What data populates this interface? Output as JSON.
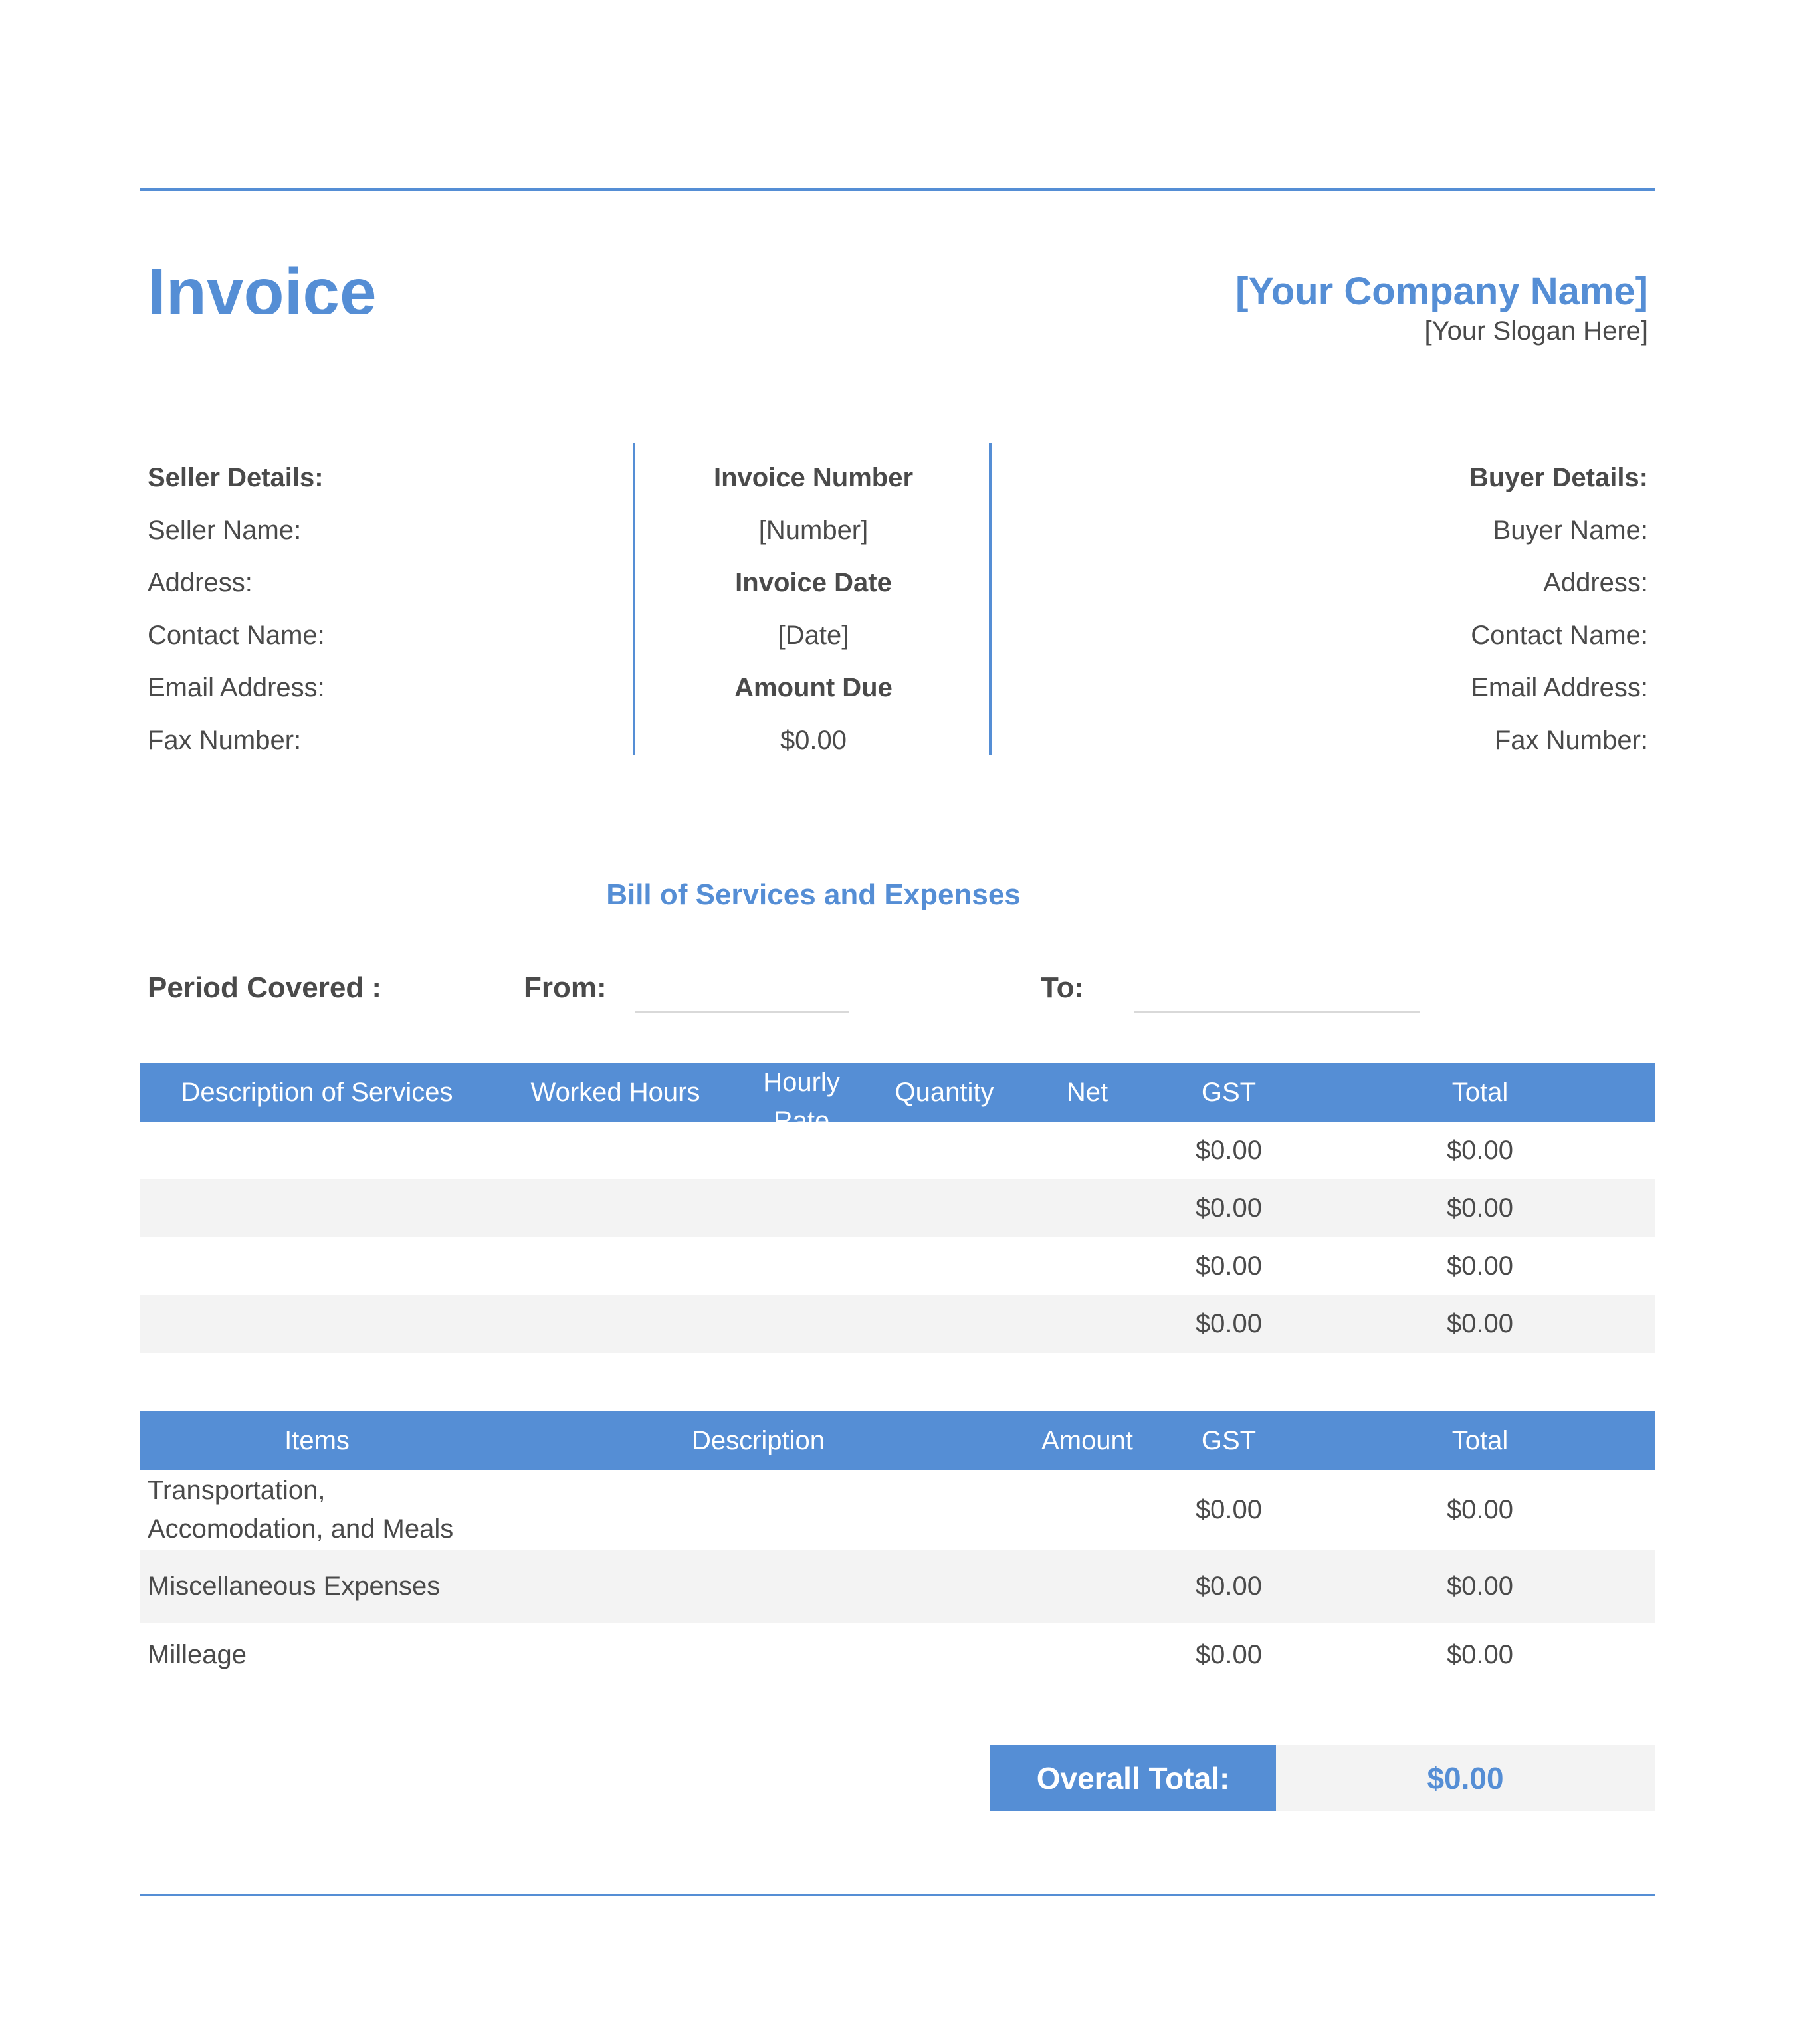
{
  "header": {
    "title": "Invoice",
    "company_name": "[Your Company Name]",
    "slogan": "[Your Slogan Here]"
  },
  "seller": {
    "heading": "Seller Details:",
    "fields": [
      "Seller Name:",
      "Address:",
      "Contact Name:",
      "Email Address:",
      "Fax Number:"
    ]
  },
  "invoice_info": {
    "number_label": "Invoice Number",
    "number_value": "[Number]",
    "date_label": "Invoice Date",
    "date_value": "[Date]",
    "amount_label": "Amount Due",
    "amount_value": "$0.00"
  },
  "buyer": {
    "heading": "Buyer Details:",
    "fields": [
      "Buyer Name:",
      "Address:",
      "Contact Name:",
      "Email Address:",
      "Fax Number:"
    ]
  },
  "bill_title": "Bill of Services and Expenses",
  "period": {
    "label": "Period Covered :",
    "from_label": "From:",
    "from_value": "",
    "to_label": "To:",
    "to_value": ""
  },
  "services_table": {
    "headers": [
      "Description of Services",
      "Worked Hours",
      "Hourly Rate",
      "Quantity",
      "Net",
      "GST",
      "Total"
    ],
    "rows": [
      [
        "",
        "",
        "",
        "",
        "",
        "$0.00",
        "$0.00"
      ],
      [
        "",
        "",
        "",
        "",
        "",
        "$0.00",
        "$0.00"
      ],
      [
        "",
        "",
        "",
        "",
        "",
        "$0.00",
        "$0.00"
      ],
      [
        "",
        "",
        "",
        "",
        "",
        "$0.00",
        "$0.00"
      ]
    ]
  },
  "expenses_table": {
    "headers": [
      "Items",
      "Description",
      "Amount",
      "GST",
      "Total"
    ],
    "rows": [
      [
        "Transportation, Accomodation, and Meals",
        "",
        "",
        "$0.00",
        "$0.00"
      ],
      [
        "Miscellaneous Expenses",
        "",
        "",
        "$0.00",
        "$0.00"
      ],
      [
        "Milleage",
        "",
        "",
        "$0.00",
        "$0.00"
      ]
    ]
  },
  "overall_total": {
    "label": "Overall Total:",
    "value": "$0.00"
  },
  "colors": {
    "accent": "#558ed5",
    "text": "#4a4a4a",
    "row_alt": "#f3f3f3"
  }
}
